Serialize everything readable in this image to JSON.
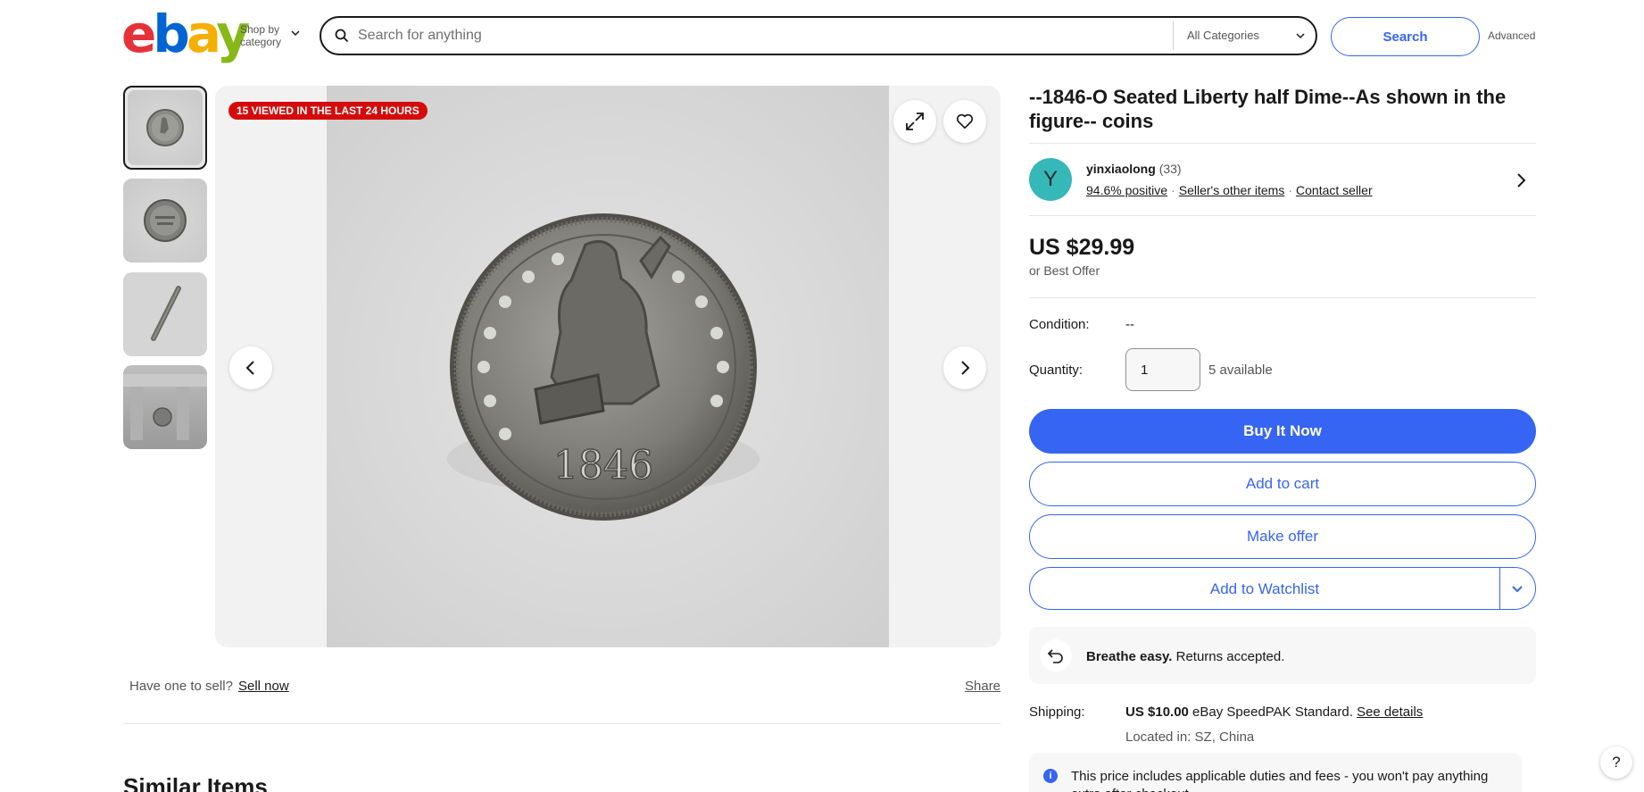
{
  "header": {
    "logo": {
      "e": "e",
      "b": "b",
      "a": "a",
      "y": "y"
    },
    "shop_by_line1": "Shop by",
    "shop_by_line2": "category",
    "search_placeholder": "Search for anything",
    "category": "All Categories",
    "search_button": "Search",
    "advanced": "Advanced"
  },
  "gallery": {
    "viewed_badge": "15 VIEWED IN THE LAST 24 HOURS",
    "main_image_year": "1846",
    "thumbnail_count": 4,
    "selected_thumbnail": 1
  },
  "listing": {
    "title": "--1846-O Seated Liberty half Dime--As shown in the figure-- coins"
  },
  "seller": {
    "avatar_letter": "Y",
    "name": "yinxiaolong",
    "feedback_count": "(33)",
    "positive": "94.6% positive",
    "other_items": "Seller's other items",
    "contact": "Contact seller"
  },
  "pricing": {
    "price": "US $29.99",
    "best_offer": "or Best Offer"
  },
  "details": {
    "condition_label": "Condition:",
    "condition_value": "--",
    "quantity_label": "Quantity:",
    "quantity_value": "1",
    "available": "5 available"
  },
  "actions": {
    "buy_now": "Buy It Now",
    "add_to_cart": "Add to cart",
    "make_offer": "Make offer",
    "add_to_watchlist": "Add to Watchlist"
  },
  "returns": {
    "bold": "Breathe easy.",
    "text": " Returns accepted."
  },
  "shipping": {
    "label": "Shipping:",
    "price": "US $10.00",
    "method": " eBay SpeedPAK Standard. ",
    "see_details": "See details",
    "located": "Located in: SZ, China",
    "notice": "This price includes applicable duties and fees - you won't pay anything extra after checkout."
  },
  "below": {
    "have_one": "Have one to sell?",
    "sell_now": "Sell now",
    "share": "Share",
    "similar_items": "Similar Items"
  },
  "help": "?"
}
